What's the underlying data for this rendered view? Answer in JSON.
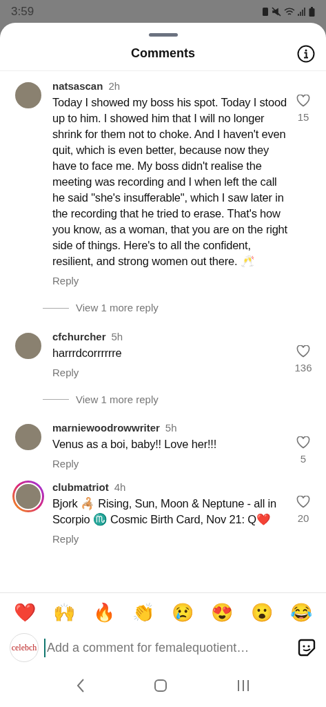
{
  "status_bar": {
    "time": "3:59"
  },
  "header": {
    "title": "Comments"
  },
  "comments": [
    {
      "username": "natsascan",
      "time": "2h",
      "text": "Today I showed my boss his spot. Today I stood up to him. I showed him that I will no longer shrink for them not to choke. And I haven't even quit, which is even better, because now they have to face me. My boss didn't realise the meeting was recording and I when left the call he said \"she's insufferable\", which I saw later in the recording that he tried to erase. That's how you know, as a woman, that you are on the right side of things. Here's to all the confident, resilient, and strong women out there. 🥂",
      "reply": "Reply",
      "likes": "15",
      "story_ring": false,
      "more_replies": "View 1 more reply"
    },
    {
      "username": "cfchurcher",
      "time": "5h",
      "text": "harrrdcorrrrrre",
      "reply": "Reply",
      "likes": "136",
      "story_ring": false,
      "more_replies": "View 1 more reply"
    },
    {
      "username": "marniewoodrowwriter",
      "time": "5h",
      "text": "Venus as a boi, baby!! Love her!!!",
      "reply": "Reply",
      "likes": "5",
      "story_ring": false
    },
    {
      "username": "clubmatriot",
      "time": "4h",
      "text": "Bjork 🦂 Rising, Sun, Moon & Neptune - all in Scorpio ♏ Cosmic Birth Card, Nov 21: Q❤️",
      "reply": "Reply",
      "likes": "20",
      "story_ring": true
    }
  ],
  "reactions": [
    "❤️",
    "🙌",
    "🔥",
    "👏",
    "😢",
    "😍",
    "😮",
    "😂"
  ],
  "composer": {
    "avatar_text": "celebch",
    "placeholder": "Add a comment for femalequotient…"
  }
}
